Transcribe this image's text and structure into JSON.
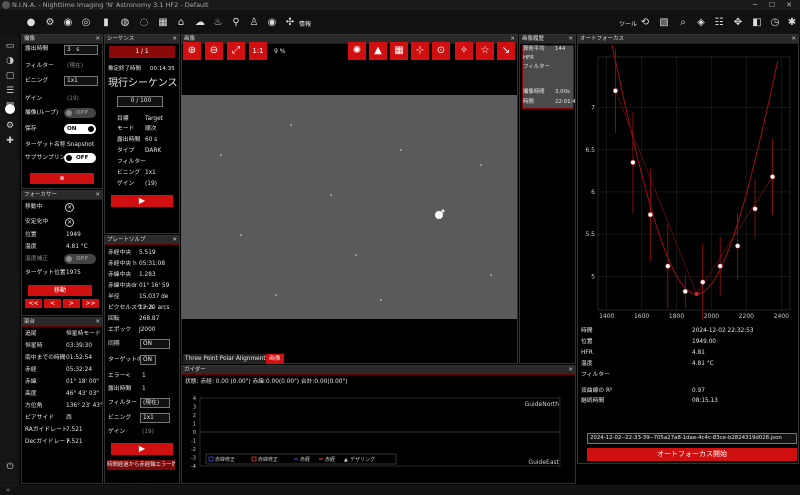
{
  "window": {
    "title": "N.I.N.A. - Nighttime Imaging 'N' Astronomy 3.1 HF2  -  Default",
    "minimize": "─",
    "maximize": "☐",
    "close": "✕"
  },
  "toolbar": {
    "info_label": "情報",
    "tools_label": "ツール"
  },
  "imaging": {
    "title": "撮像",
    "rows": {
      "exposure": "露出時間",
      "filter": "フィルター",
      "binning": "ビニング",
      "gain": "ゲイン",
      "loop": "撮像(ループ)",
      "save": "保存",
      "target": "ターゲット名称",
      "subsample": "サブサンプリング"
    },
    "exposure_value": "3",
    "exposure_unit": "s",
    "filter_value": "(現在)",
    "binning_value": "1x1",
    "gain_value": "(19)",
    "loop_value": "OFF",
    "save_value": "ON",
    "target_value": "Snapshot",
    "subsample_value": "OFF",
    "stop_icon": "⊗"
  },
  "focuser": {
    "title": "フォーカサー",
    "rows": [
      "移動中",
      "安定化中",
      "位置",
      "温度",
      "温度補正",
      "ターゲット位置"
    ],
    "position": "1949",
    "temperature": "4.81 °C",
    "temp_comp": "OFF",
    "target_pos": "1975",
    "move_label": "移動",
    "steps": [
      "<<",
      "<",
      ">",
      ">>"
    ]
  },
  "mount": {
    "title": "架台",
    "rows": [
      "追尾",
      "恒星時",
      "南中までの時間",
      "赤経",
      "赤緯",
      "高度",
      "方位角",
      "ピアサイド",
      "RAガイドレート",
      "Decガイドレート"
    ],
    "values": [
      "恒星時モード",
      "03:39:30",
      "01:52:54",
      "05:32:24",
      "01° 18' 00\"",
      "46° 43' 03\"",
      "136° 23' 43\"",
      "西",
      "7.521",
      "7.521"
    ]
  },
  "sequence": {
    "title": "シーケンス",
    "counter": "1 / 1",
    "eta_label": "推定終了時間",
    "eta_value": "00:14:35",
    "current_label": "現行シーケンス",
    "progress": "0 / 100",
    "rows": [
      "目標",
      "モード",
      "露出時間",
      "タイプ",
      "フィルター",
      "ビニング",
      "ゲイン"
    ],
    "values": [
      "Target",
      "順次",
      "60 s",
      "DARK",
      "",
      "1x1",
      "(19)"
    ]
  },
  "platesolve": {
    "title": "プレートソルブ",
    "rows": [
      "赤経中央",
      "赤経中央 h",
      "赤緯中央",
      "赤緯中央dr",
      "半径",
      "ピクセルスケール",
      "回転",
      "エポック"
    ],
    "values": [
      "5.519",
      "05:31:08",
      "1.283",
      "01° 16' 59",
      "15.037 de",
      "12.20 arcs",
      "268.87",
      "J2000"
    ],
    "sync_label": "同期",
    "sync_value": "ON",
    "reslew_label": "ターゲットの再",
    "reslew_value": "ON",
    "error_label": "エラー<",
    "error_value": "1",
    "exp_label": "露出時間",
    "exp_value": "1",
    "filter_label": "フィルター",
    "filter_value": "(現在)",
    "bin_label": "ビニング",
    "bin_value": "1x1",
    "gain_label": "ゲイン",
    "gain_value": "(19)",
    "footer": "時間経過から赤経軸エラー許容"
  },
  "image": {
    "title": "画像",
    "zoom": "9 %",
    "one_to_one": "1:1",
    "tab_tppa": "Three Point Polar Alignment",
    "tab_image": "画像"
  },
  "history": {
    "title": "画像履歴",
    "rows": [
      "算術平均",
      "HFR",
      "フィルター",
      "",
      "撮像時間",
      "時間"
    ],
    "values": [
      "144",
      "",
      "",
      "",
      "3.00s",
      "22:01:4"
    ]
  },
  "guider": {
    "title": "ガイダー",
    "status": "状態:  赤経: 0.00 (0.00\")  赤緯:0.00(0.00\")  合計:0.00(0.00\")",
    "top_label": "GuideNorth",
    "bottom_label": "GuideEast",
    "yticks": [
      "4",
      "3",
      "2",
      "1",
      "0",
      "-1",
      "-2",
      "-3",
      "-4"
    ],
    "legend": [
      "赤緯修正",
      "赤緯修正",
      "赤経",
      "赤経",
      "デザリング"
    ]
  },
  "autofocus": {
    "title": "オートフォーカス",
    "rows": [
      "時間",
      "位置",
      "HFR",
      "温度",
      "フィルター",
      "",
      "双曲線の R²",
      "継続時間"
    ],
    "values": [
      "2024-12-02 22:32:53",
      "1949.00",
      "4.81",
      "4.81 °C",
      "",
      "",
      "0.97",
      "08:15.13"
    ],
    "file": "2024-12-02--22-33-39--705a27a8-1dae-4c4c-83ce-b2824319d028.json",
    "start_label": "オートフォーカス開始"
  },
  "chart_data": {
    "type": "scatter",
    "xlim": [
      1350,
      2450
    ],
    "ylim": [
      4.6,
      7.6
    ],
    "xticks": [
      "1400",
      "1600",
      "1800",
      "2000",
      "2200",
      "2400"
    ],
    "yticks": [
      "7",
      "6.5",
      "6",
      "5.5",
      "5"
    ],
    "x": [
      1450,
      1550,
      1650,
      1750,
      1850,
      1950,
      2050,
      2150,
      2250,
      2350
    ],
    "y": [
      7.2,
      6.35,
      5.73,
      5.12,
      4.82,
      4.93,
      5.12,
      5.36,
      5.8,
      6.18
    ],
    "err": [
      0.5,
      0.6,
      0.55,
      0.5,
      0.2,
      0.45,
      0.35,
      0.4,
      0.35,
      0.45
    ],
    "fit_min": [
      1915,
      4.79
    ]
  }
}
